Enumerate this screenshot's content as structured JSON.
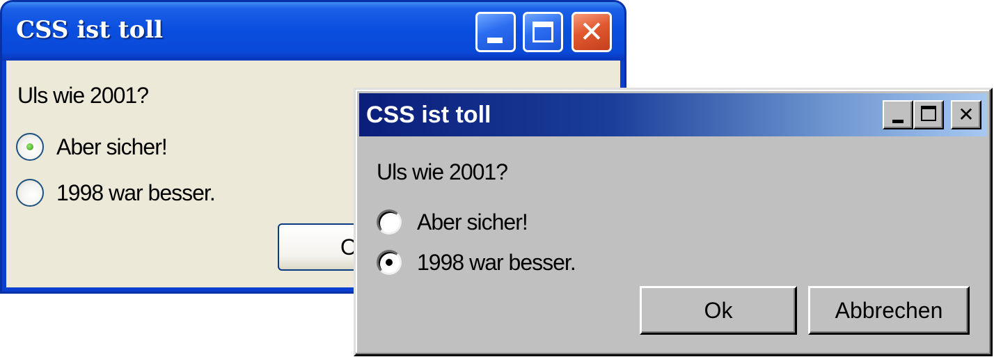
{
  "xp_window": {
    "title": "CSS ist toll",
    "question": "Uls wie 2001?",
    "options": [
      {
        "label": "Aber sicher!",
        "selected": true
      },
      {
        "label": "1998 war besser.",
        "selected": false
      }
    ],
    "ok_label": "Ok",
    "colors": {
      "titlebar": "#0a4fe0",
      "body": "#ece9d8",
      "close_button": "#e1582f"
    },
    "icons": {
      "minimize": "minimize-icon",
      "maximize": "maximize-icon",
      "close": "close-icon",
      "close_glyph": "✕"
    }
  },
  "classic_window": {
    "title": "CSS ist toll",
    "question": "Uls wie 2001?",
    "options": [
      {
        "label": "Aber sicher!",
        "selected": false
      },
      {
        "label": "1998 war besser.",
        "selected": true
      }
    ],
    "ok_label": "Ok",
    "cancel_label": "Abbrechen",
    "colors": {
      "titlebar_start": "#0a1e7a",
      "titlebar_end": "#a6c8f0",
      "body": "#c0c0c0"
    },
    "icons": {
      "minimize": "minimize-icon",
      "maximize": "maximize-icon",
      "close": "close-icon",
      "close_glyph": "✕"
    }
  }
}
